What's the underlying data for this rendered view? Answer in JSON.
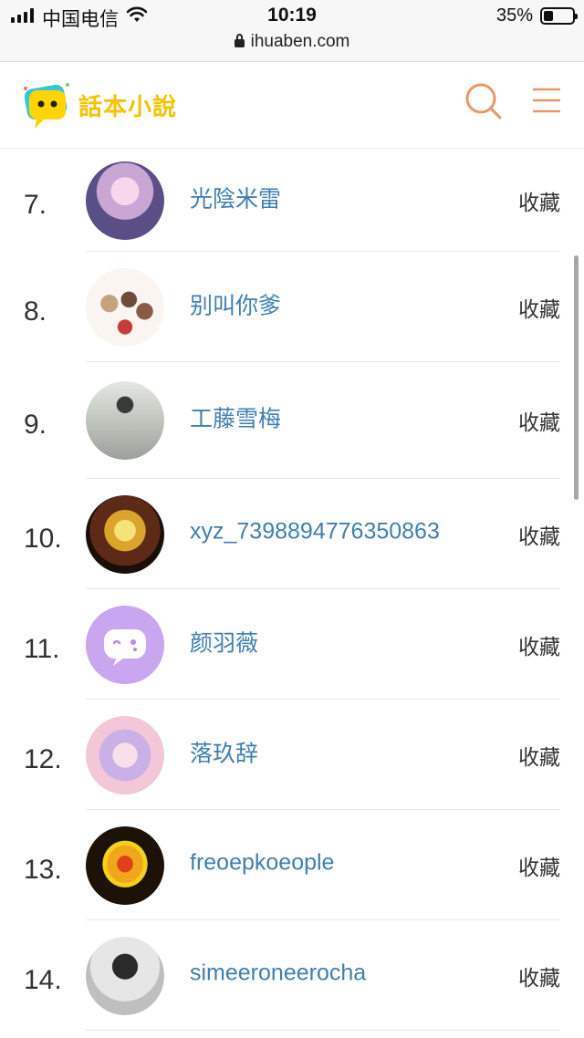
{
  "status_bar": {
    "carrier": "中国电信",
    "time": "10:19",
    "battery": "35%",
    "battery_level": 0.35,
    "url": "ihuaben.com"
  },
  "header": {
    "logo_text": "話本小說"
  },
  "colors": {
    "accent": "#e8996a",
    "link": "#3f7fb3",
    "logo_yellow": "#f5c200"
  },
  "list": [
    {
      "rank": "7.",
      "name": "光陰米雷",
      "fav": "收藏"
    },
    {
      "rank": "8.",
      "name": "别叫你爹",
      "fav": "收藏"
    },
    {
      "rank": "9.",
      "name": "工藤雪梅",
      "fav": "收藏"
    },
    {
      "rank": "10.",
      "name": "xyz_7398894776350863",
      "fav": "收藏"
    },
    {
      "rank": "11.",
      "name": "颜羽薇",
      "fav": "收藏"
    },
    {
      "rank": "12.",
      "name": "落玖辞",
      "fav": "收藏"
    },
    {
      "rank": "13.",
      "name": "freoepkoeople",
      "fav": "收藏"
    },
    {
      "rank": "14.",
      "name": "simeeroneerocha",
      "fav": "收藏"
    }
  ]
}
